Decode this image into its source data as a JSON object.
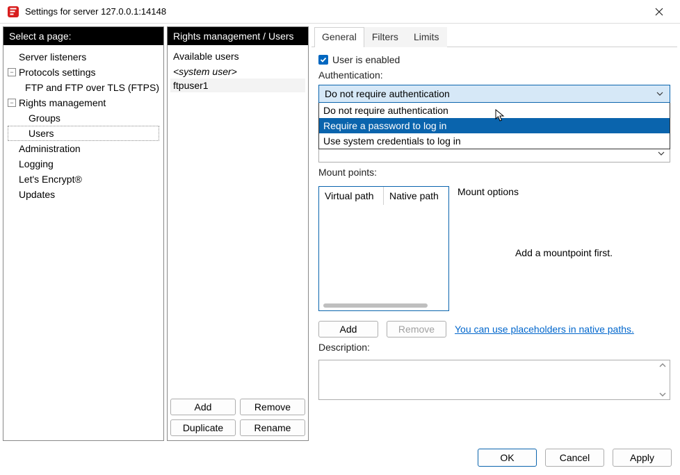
{
  "titlebar": {
    "title": "Settings for server 127.0.0.1:14148"
  },
  "left": {
    "header": "Select a page:",
    "nodes": {
      "server_listeners": "Server listeners",
      "protocols": "Protocols settings",
      "ftp_tls": "FTP and FTP over TLS (FTPS)",
      "rights": "Rights management",
      "groups": "Groups",
      "users": "Users",
      "admin": "Administration",
      "logging": "Logging",
      "letsencrypt": "Let's Encrypt®",
      "updates": "Updates"
    }
  },
  "mid": {
    "header": "Rights management / Users",
    "available_label": "Available users",
    "sysuser": "<system user>",
    "users": [
      "ftpuser1"
    ],
    "buttons": {
      "add": "Add",
      "remove": "Remove",
      "duplicate": "Duplicate",
      "rename": "Rename"
    }
  },
  "right": {
    "tabs": {
      "general": "General",
      "filters": "Filters",
      "limits": "Limits"
    },
    "enabled_label": "User is enabled",
    "auth_label": "Authentication:",
    "auth_selected": "Do not require authentication",
    "auth_options": [
      "Do not require authentication",
      "Require a password to log in",
      "Use system credentials to log in"
    ],
    "mount_label": "Mount points:",
    "mount_headers": {
      "virtual": "Virtual path",
      "native": "Native path"
    },
    "mount_options_label": "Mount options",
    "mount_empty_msg": "Add a mountpoint first.",
    "mount_buttons": {
      "add": "Add",
      "remove": "Remove"
    },
    "placeholder_link": "You can use placeholders in native paths.",
    "description_label": "Description:"
  },
  "footer": {
    "ok": "OK",
    "cancel": "Cancel",
    "apply": "Apply"
  }
}
